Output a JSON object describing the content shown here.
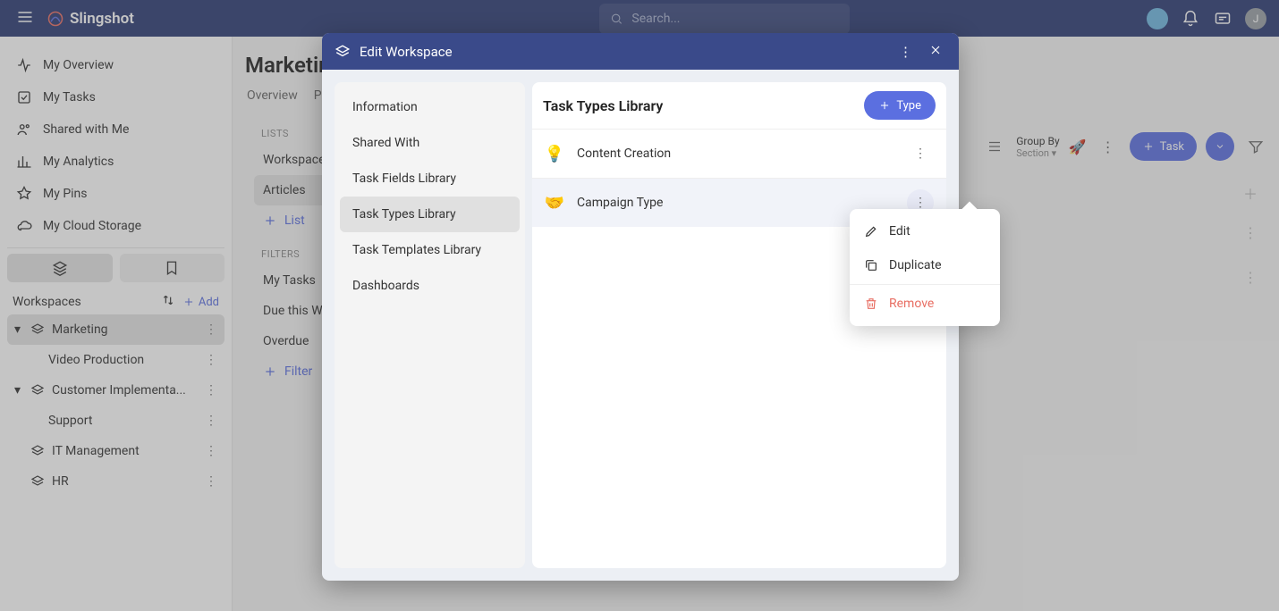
{
  "brand": "Slingshot",
  "search": {
    "placeholder": "Search..."
  },
  "userInitial": "J",
  "sidebar": {
    "items": [
      {
        "label": "My Overview"
      },
      {
        "label": "My Tasks"
      },
      {
        "label": "Shared with Me"
      },
      {
        "label": "My Analytics"
      },
      {
        "label": "My Pins"
      },
      {
        "label": "My Cloud Storage"
      }
    ],
    "workspacesLabel": "Workspaces",
    "addLabel": "Add",
    "workspaces": [
      {
        "label": "Marketing",
        "selected": true,
        "expanded": true,
        "children": [
          {
            "label": "Video Production"
          }
        ]
      },
      {
        "label": "Customer Implementa...",
        "expanded": true,
        "children": [
          {
            "label": "Support"
          }
        ]
      },
      {
        "label": "IT Management"
      },
      {
        "label": "HR"
      }
    ]
  },
  "page": {
    "title": "Marketin",
    "tabs": [
      "Overview",
      "Pr"
    ]
  },
  "panel": {
    "listsLabel": "LISTS",
    "lists": [
      "Workspace T",
      "Articles"
    ],
    "addListLabel": "List",
    "filtersLabel": "FILTERS",
    "filters": [
      "My Tasks",
      "Due this Wee",
      "Overdue"
    ],
    "addFilterLabel": "Filter",
    "activeList": "Articles"
  },
  "toolbar": {
    "groupByLabel": "Group By",
    "groupByValue": "Section",
    "taskLabel": "Task"
  },
  "modal": {
    "title": "Edit Workspace",
    "leftItems": [
      "Information",
      "Shared With",
      "Task Fields Library",
      "Task Types Library",
      "Task Templates Library",
      "Dashboards"
    ],
    "activeLeft": "Task Types Library",
    "rightTitle": "Task Types Library",
    "typeButton": "Type",
    "taskTypes": [
      {
        "icon": "💡",
        "label": "Content Creation"
      },
      {
        "icon": "🤝",
        "label": "Campaign Type",
        "menuOpen": true
      }
    ]
  },
  "contextMenu": {
    "edit": "Edit",
    "duplicate": "Duplicate",
    "remove": "Remove"
  }
}
